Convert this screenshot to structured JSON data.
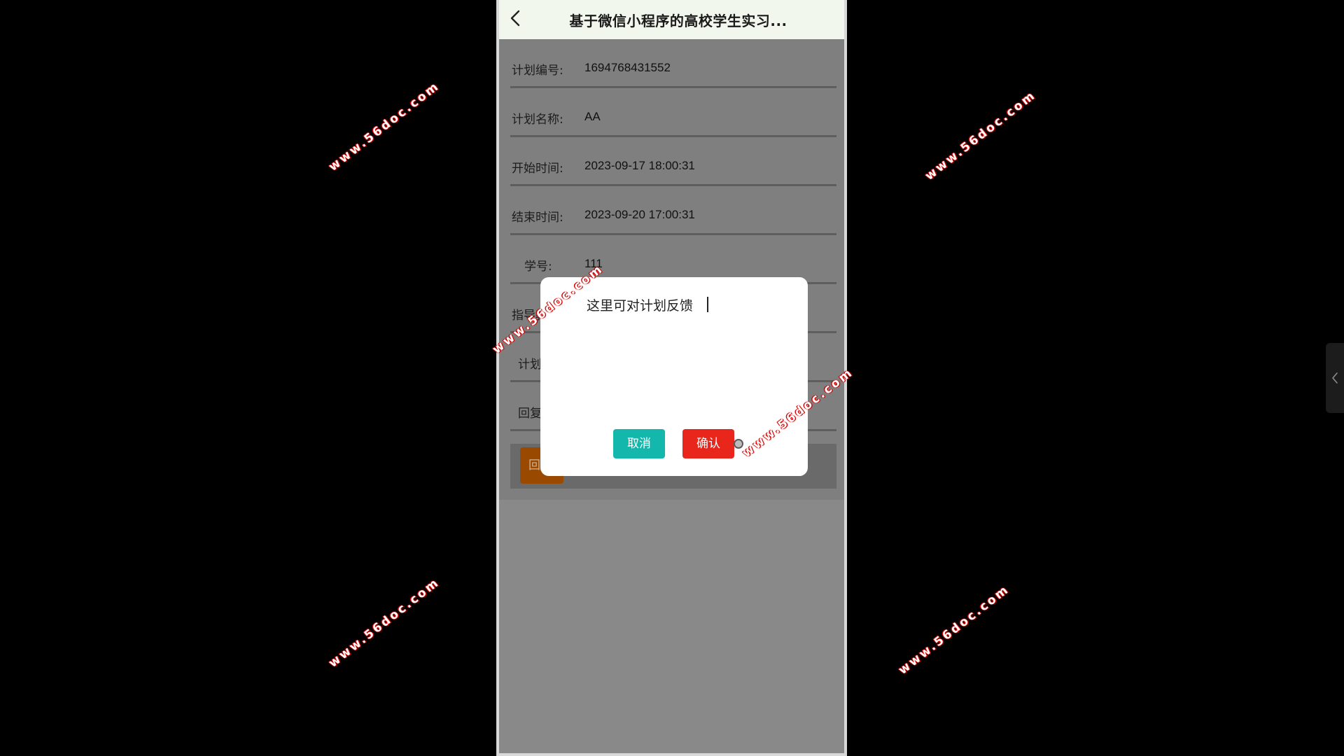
{
  "navbar": {
    "title": "基于微信小程序的高校学生实习..."
  },
  "form": {
    "rows": [
      {
        "label": "计划编号:",
        "value": "1694768431552"
      },
      {
        "label": "计划名称:",
        "value": "AA"
      },
      {
        "label": "开始时间:",
        "value": "2023-09-17 18:00:31"
      },
      {
        "label": "结束时间:",
        "value": "2023-09-20 17:00:31"
      },
      {
        "label": "学号:",
        "value": "111"
      },
      {
        "label": "指导教",
        "value": ""
      },
      {
        "label": "计划",
        "value": ""
      },
      {
        "label": "回复",
        "value": ""
      }
    ]
  },
  "action": {
    "button_label": "回"
  },
  "modal": {
    "textarea_value": "这里可对计划反馈",
    "cancel_label": "取消",
    "confirm_label": "确认"
  },
  "watermark": {
    "text": "www.56doc.com"
  },
  "colors": {
    "navbar_bg": "#f2f7ee",
    "cancel": "#14b7ac",
    "confirm": "#e8261c",
    "feedback_button": "#9a4a00",
    "overlay": "#7f7f7f"
  },
  "icons": {
    "back": "chevron-left-icon",
    "side_handle": "chevron-left-icon"
  }
}
